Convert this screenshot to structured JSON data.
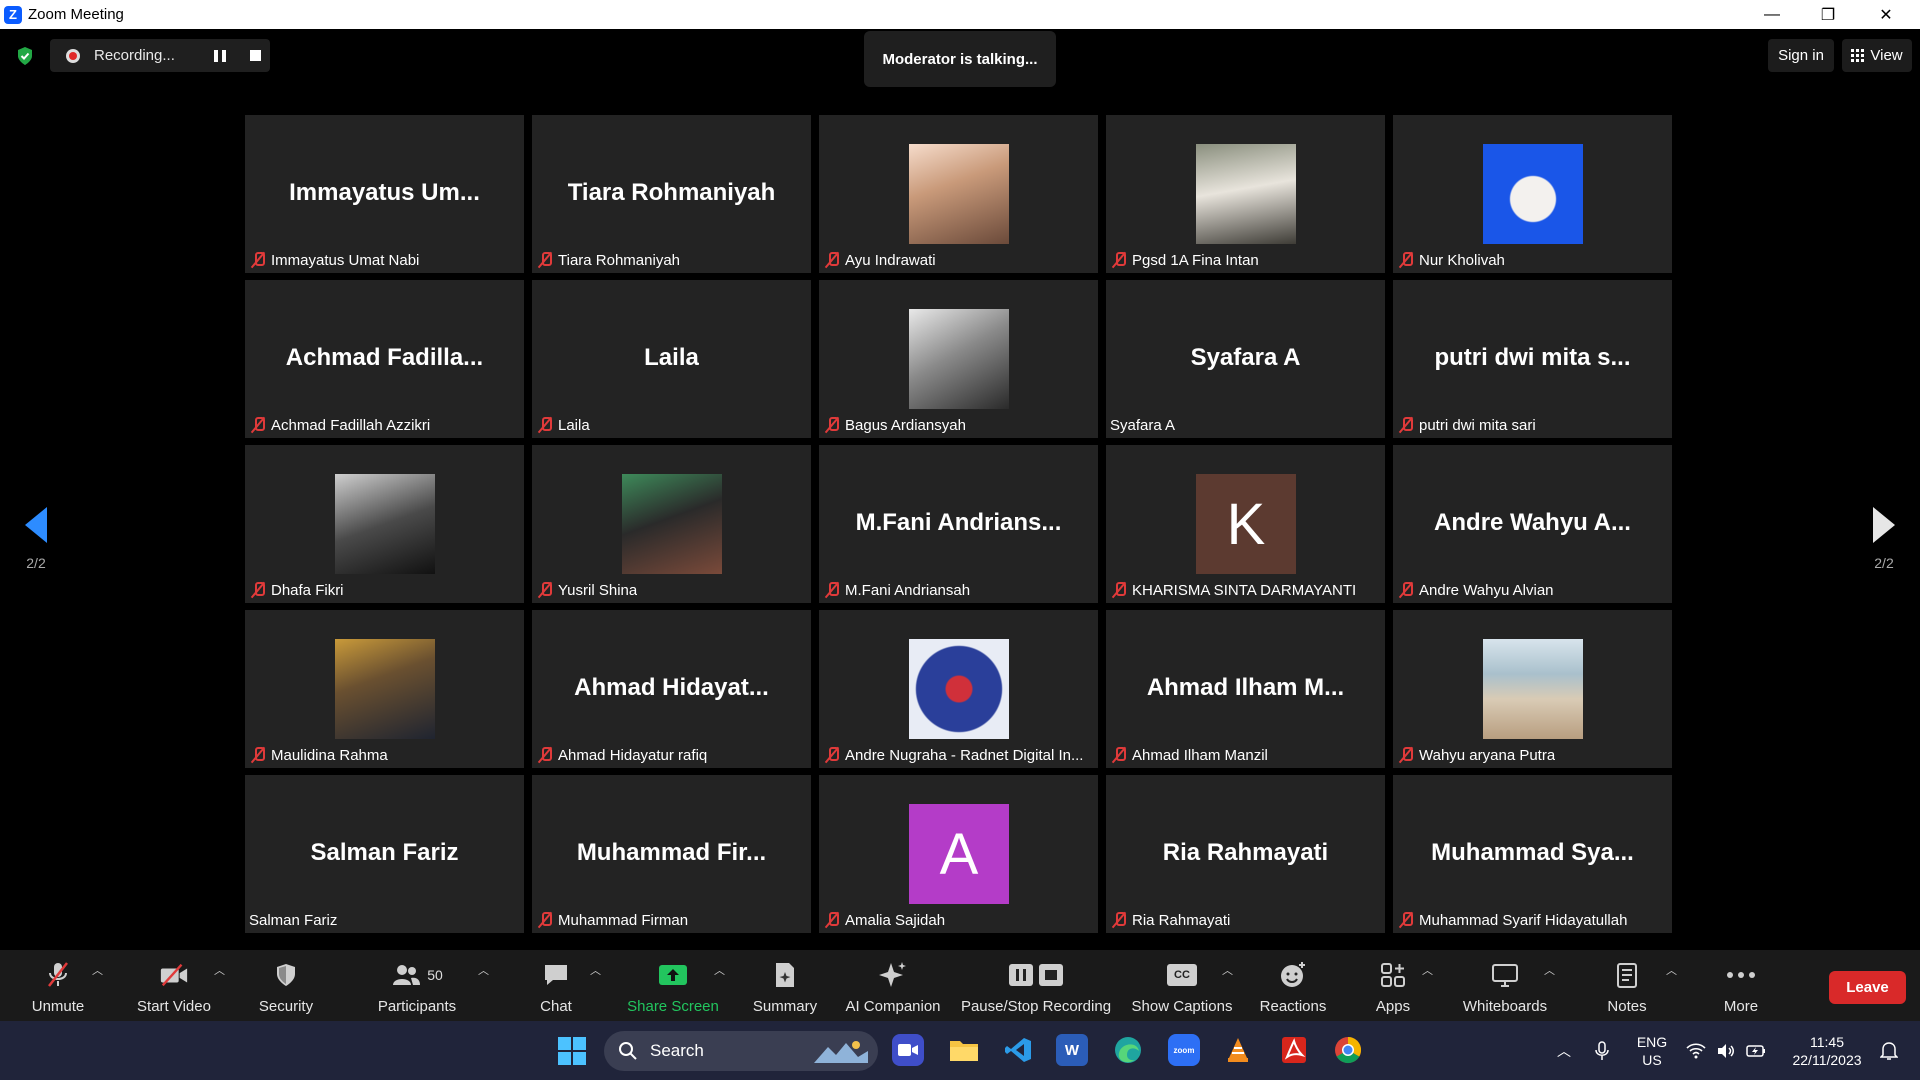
{
  "window": {
    "title": "Zoom Meeting",
    "minimize_glyph": "—",
    "restore_glyph": "❐",
    "close_glyph": "✕"
  },
  "topbar": {
    "recording_label": "Recording...",
    "moderator_banner": "Moderator is talking...",
    "signin_label": "Sign in",
    "view_label": "View"
  },
  "pagination": {
    "left": "2/2",
    "right": "2/2"
  },
  "participants": [
    {
      "big": "Immayatus  Um...",
      "name": "Immayatus Umat Nabi",
      "muted": true
    },
    {
      "big": "Tiara Rohmaniyah",
      "name": "Tiara Rohmaniyah",
      "muted": true
    },
    {
      "photo": "anime-avatar",
      "name": "Ayu Indrawati",
      "muted": true
    },
    {
      "photo": "hijab-outdoor-photo",
      "name": "Pgsd 1A Fina Intan",
      "muted": true
    },
    {
      "photo": "hijab-blue-portrait",
      "name": "Nur Kholivah",
      "muted": true
    },
    {
      "big": "Achmad  Fadilla...",
      "name": "Achmad Fadillah Azzikri",
      "muted": true
    },
    {
      "big": "Laila",
      "name": "Laila",
      "muted": true
    },
    {
      "photo": "helmet-bw-photo",
      "name": "Bagus Ardiansyah",
      "muted": true
    },
    {
      "big": "Syafara A",
      "name": "Syafara A",
      "muted": false
    },
    {
      "big": "putri dwi mita s...",
      "name": "putri dwi mita sari",
      "muted": true
    },
    {
      "photo": "mirror-selfie-photo",
      "name": "Dhafa Fikri",
      "muted": true
    },
    {
      "photo": "crowd-masked-photo",
      "name": "Yusril Shina",
      "muted": true
    },
    {
      "big": "M.Fani  Andrians...",
      "name": "M.Fani Andriansah",
      "muted": true
    },
    {
      "letter": "K",
      "letter_color": "#5c3a30",
      "name": "KHARISMA SINTA DARMAYANTI",
      "muted": true
    },
    {
      "big": "Andre  Wahyu  A...",
      "name": "Andre Wahyu Alvian",
      "muted": true
    },
    {
      "photo": "hijab-mask-photo",
      "name": "Maulidina Rahma",
      "muted": true
    },
    {
      "big": "Ahmad  Hidayat...",
      "name": "Ahmad Hidayatur rafiq",
      "muted": true
    },
    {
      "photo": "anime-winter-avatar",
      "name": "Andre Nugraha - Radnet Digital In...",
      "muted": true
    },
    {
      "big": "Ahmad  Ilham  M...",
      "name": "Ahmad Ilham Manzil",
      "muted": true
    },
    {
      "photo": "beach-photo",
      "name": "Wahyu aryana Putra",
      "muted": true
    },
    {
      "big": "Salman Fariz",
      "name": "Salman Fariz",
      "muted": false
    },
    {
      "big": "Muhammad  Fir...",
      "name": "Muhammad Firman",
      "muted": true
    },
    {
      "letter": "A",
      "letter_color": "#b43cc8",
      "name": "Amalia Sajidah",
      "muted": true
    },
    {
      "big": "Ria Rahmayati",
      "name": "Ria Rahmayati",
      "muted": true
    },
    {
      "big": "Muhammad  Sya...",
      "name": "Muhammad Syarif Hidayatullah",
      "muted": true
    }
  ],
  "toolbar": {
    "unmute": "Unmute",
    "start_video": "Start Video",
    "security": "Security",
    "participants": "Participants",
    "participants_count": "50",
    "chat": "Chat",
    "share_screen": "Share Screen",
    "summary": "Summary",
    "ai_companion": "AI Companion",
    "pause_stop_recording": "Pause/Stop Recording",
    "show_captions": "Show Captions",
    "captions_badge": "CC",
    "reactions": "Reactions",
    "apps": "Apps",
    "whiteboards": "Whiteboards",
    "notes": "Notes",
    "more": "More",
    "leave": "Leave"
  },
  "taskbar": {
    "search_label": "Search",
    "lang_top": "ENG",
    "lang_bottom": "US",
    "time": "11:45",
    "date": "22/11/2023",
    "zoom_icon_text": "zoom",
    "word_icon_text": "W"
  },
  "colors": {
    "accent": "#2d8cff",
    "leave": "#d92929",
    "share": "#22c55e",
    "muted": "#e03a3a"
  }
}
